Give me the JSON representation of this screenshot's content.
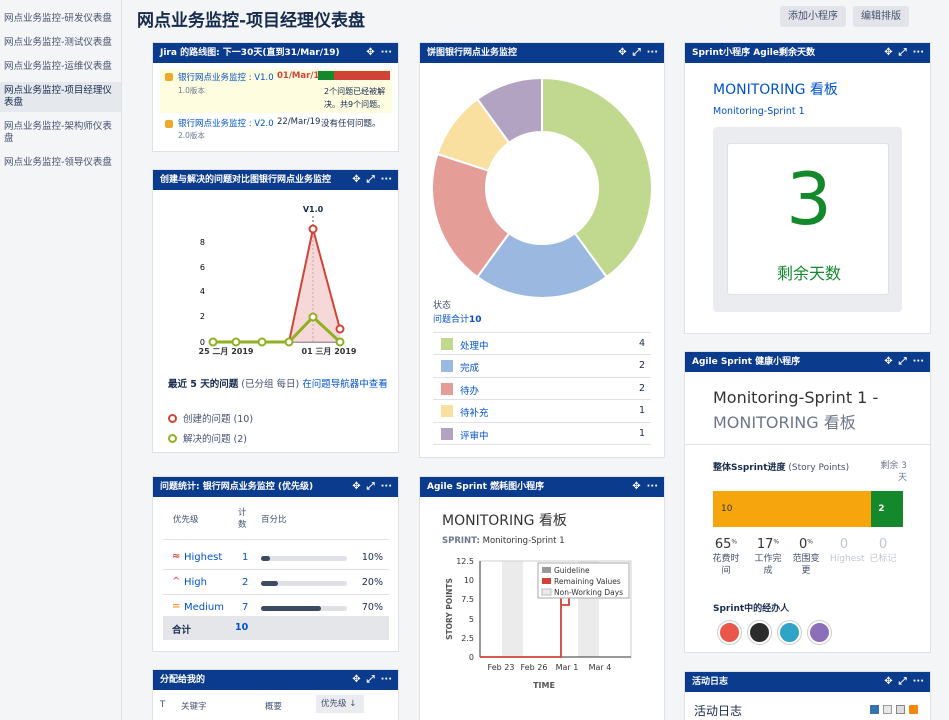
{
  "sidebar": {
    "items": [
      "网点业务监控-研发仪表盘",
      "网点业务监控-测试仪表盘",
      "网点业务监控-运维仪表盘",
      "网点业务监控-项目经理仪表盘",
      "网点业务监控-架构师仪表盘",
      "网点业务监控-领导仪表盘"
    ],
    "active_index": 3
  },
  "header": {
    "title": "网点业务监控-项目经理仪表盘",
    "add_gadget": "添加小程序",
    "edit_layout": "编辑排版"
  },
  "icons": {
    "move": "✥",
    "expand": "⤢",
    "more": "···",
    "sort": "↓"
  },
  "roadmap": {
    "title": "Jira 的路线图: 下一30天(直到31/Mar/19)",
    "rows": [
      {
        "name": "银行网点业务监控 : V1.0",
        "sub": "1.0版本",
        "date": "01/Mar/19",
        "overdue": true,
        "desc": "2个问题已经被解决。共9个问题。",
        "done_fraction": 0.22
      },
      {
        "name": "银行网点业务监控 : V2.0",
        "sub": "2.0版本",
        "date": "22/Mar/19",
        "overdue": false,
        "desc": "没有任何问题。"
      }
    ]
  },
  "created_resolved": {
    "title": "创建与解决的问题对比图银行网点业务监控",
    "version_label": "V1.0",
    "desc_bold": "最近 5 天的问题",
    "desc_rest": "(已分组 每日)",
    "desc_link": "在问题导航器中查看",
    "legend_created": "创建的问题 (10)",
    "legend_resolved": "解决的问题 (2)"
  },
  "priority": {
    "title": "问题统计: 银行网点业务监控 (优先级)",
    "headers": {
      "priority": "优先级",
      "count": "计数",
      "percent": "百分比"
    },
    "rows": [
      {
        "name": "Highest",
        "count": "1",
        "percent": "10%",
        "fraction": 0.1,
        "color": "#d04437",
        "icon": "double-chevron-up-icon",
        "glyph": "≈"
      },
      {
        "name": "High",
        "count": "2",
        "percent": "20%",
        "fraction": 0.2,
        "color": "#f15c75",
        "icon": "chevron-up-icon",
        "glyph": "^"
      },
      {
        "name": "Medium",
        "count": "7",
        "percent": "70%",
        "fraction": 0.7,
        "color": "#f79232",
        "icon": "equals-icon",
        "glyph": "="
      }
    ],
    "total_label": "合计",
    "total": "10"
  },
  "assigned": {
    "title": "分配给我的",
    "headers": {
      "t": "T",
      "key": "关键字",
      "summary": "概要",
      "priority": "优先级"
    }
  },
  "pie": {
    "title": "饼图银行网点业务监控",
    "status_label": "状态",
    "total_label": "问题合计",
    "total": "10",
    "rows": [
      {
        "label": "处理中",
        "value": 4,
        "color": "#c1d88f"
      },
      {
        "label": "完成",
        "value": 2,
        "color": "#9bb9e0"
      },
      {
        "label": "待办",
        "value": 2,
        "color": "#e59d98"
      },
      {
        "label": "待补充",
        "value": 1,
        "color": "#f9dfa0"
      },
      {
        "label": "评审中",
        "value": 1,
        "color": "#b2a3c2"
      }
    ]
  },
  "burndown": {
    "title": "Agile Sprint 燃耗图小程序",
    "board": "MONITORING 看板",
    "sprint_label": "SPRINT:",
    "sprint_name": "Monitoring-Sprint 1",
    "ylabel": "STORY POINTS",
    "xlabel": "TIME",
    "yticks": [
      "12.5",
      "10",
      "7.5",
      "5",
      "2.5",
      "0"
    ],
    "xticks": [
      "Feb 23",
      "Feb 26",
      "Mar 1",
      "Mar 4"
    ],
    "legend": [
      "Guideline",
      "Remaining Values",
      "Non-Working Days"
    ],
    "legend_colors": [
      "#999999",
      "#d04437",
      "#ebebeb"
    ]
  },
  "days_remaining": {
    "title": "Sprint小程序 Agile剩余天数",
    "board": "MONITORING 看板",
    "sprint": "Monitoring-Sprint 1",
    "number": "3",
    "label": "剩余天数"
  },
  "sprint_health": {
    "title": "Agile Sprint 健康小程序",
    "heading1": "Monitoring-Sprint 1 -",
    "heading2": "MONITORING 看板",
    "progress_label": "整体Ssprint进度",
    "progress_unit": "(Story Points)",
    "remaining_label": "剩余 3 天",
    "bar_todo": "10",
    "bar_done": "2",
    "todo_fraction": 0.833,
    "stats": [
      {
        "value": "65",
        "unit": "%",
        "label": "花费时间",
        "muted": false
      },
      {
        "value": "17",
        "unit": "%",
        "label": "工作完成",
        "muted": false
      },
      {
        "value": "0",
        "unit": "%",
        "label": "范围变更",
        "muted": false
      },
      {
        "value": "0",
        "unit": "",
        "label": "Highest",
        "muted": true
      },
      {
        "value": "0",
        "unit": "",
        "label": "已标记",
        "muted": true
      }
    ],
    "people_label": "Sprint中的经办人"
  },
  "activity": {
    "title": "活动日志",
    "heading": "活动日志"
  }
}
